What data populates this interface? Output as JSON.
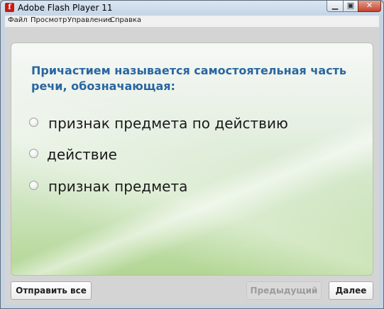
{
  "window": {
    "title": "Adobe Flash Player 11",
    "app_icon_glyph": "f",
    "min_glyph": "▁",
    "max_glyph": "▣",
    "close_glyph": "✕"
  },
  "menu": [
    "Файл",
    "Просмотр",
    "Управление",
    "Справка"
  ],
  "quiz": {
    "question": "Причастием называется самостоятельная часть речи, обозначающая:",
    "options": [
      "признак предмета по действию",
      "действие",
      "признак предмета"
    ]
  },
  "buttons": {
    "submit_all": "Отправить все",
    "previous": "Предыдущий",
    "next": "Далее"
  },
  "colors": {
    "question_text": "#2a66a0",
    "close_button": "#c4442c"
  }
}
